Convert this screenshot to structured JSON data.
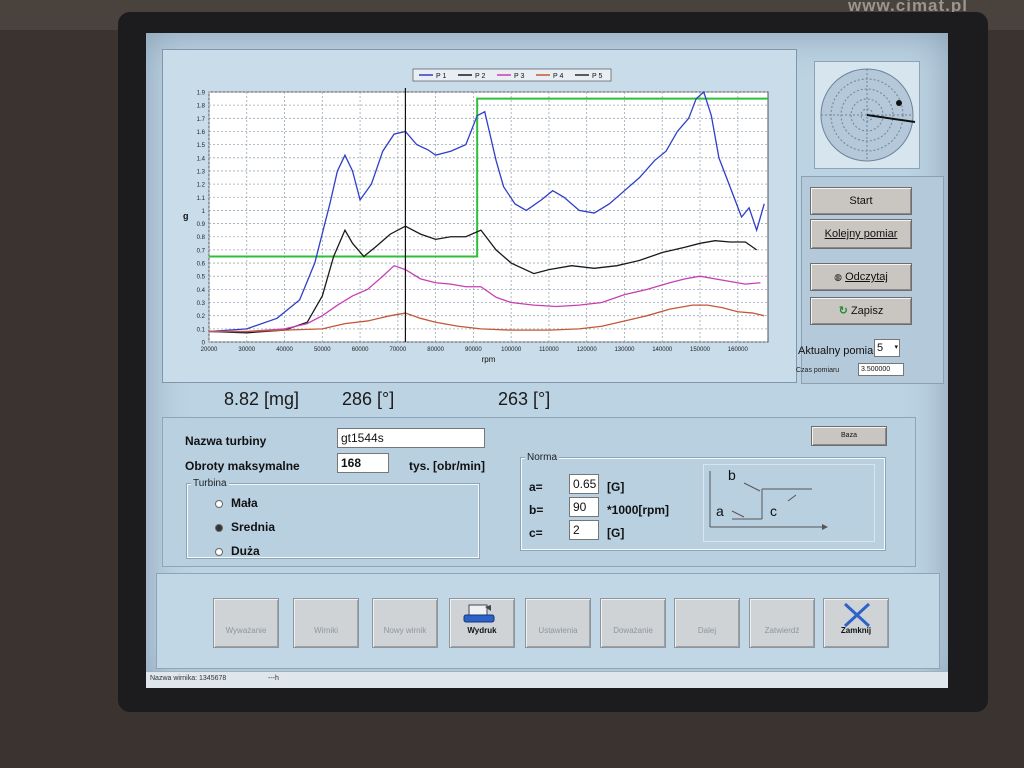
{
  "colors": {
    "p1": "#2f3fc8",
    "p2": "#1a1a1a",
    "p3": "#c83fb3",
    "p4": "#c2583a",
    "p5": "#2a2a2a",
    "threshold": "#2ec03a"
  },
  "chart_data": {
    "type": "line",
    "xlabel": "rpm",
    "ylabel": "g",
    "xlim": [
      20000,
      168000
    ],
    "ylim": [
      0,
      1.9
    ],
    "x_ticks": [
      20000,
      30000,
      40000,
      50000,
      60000,
      70000,
      80000,
      90000,
      100000,
      110000,
      120000,
      130000,
      140000,
      150000,
      160000
    ],
    "y_ticks": [
      0,
      0.1,
      0.2,
      0.3,
      0.4,
      0.5,
      0.6,
      0.7,
      0.8,
      0.9,
      1,
      1.1,
      1.2,
      1.3,
      1.4,
      1.5,
      1.6,
      1.7,
      1.8,
      1.9
    ],
    "legend_position": "top-center",
    "grid": true,
    "cursor_x": 72000,
    "series": [
      {
        "name": "P 1",
        "x": [
          20000,
          30000,
          38000,
          44000,
          48000,
          52000,
          54000,
          56000,
          58000,
          60000,
          63000,
          66000,
          69000,
          72000,
          75000,
          78000,
          80000,
          84000,
          88000,
          91000,
          93000,
          96000,
          98000,
          101000,
          104000,
          108000,
          111000,
          114000,
          118000,
          122000,
          126000,
          130000,
          134000,
          138000,
          141000,
          144000,
          147000,
          149000,
          151000,
          153000,
          155000,
          157000,
          159000,
          161000,
          163000,
          165000,
          167000
        ],
        "values": [
          0.08,
          0.1,
          0.18,
          0.32,
          0.6,
          1.05,
          1.3,
          1.42,
          1.3,
          1.08,
          1.2,
          1.45,
          1.58,
          1.6,
          1.5,
          1.46,
          1.42,
          1.45,
          1.5,
          1.72,
          1.75,
          1.38,
          1.18,
          1.05,
          1.0,
          1.08,
          1.15,
          1.1,
          1.0,
          0.98,
          1.05,
          1.15,
          1.25,
          1.38,
          1.45,
          1.6,
          1.7,
          1.85,
          1.9,
          1.72,
          1.4,
          1.25,
          1.1,
          0.95,
          1.02,
          0.85,
          1.05
        ]
      },
      {
        "name": "P 2",
        "x": [
          20000,
          30000,
          40000,
          46000,
          50000,
          53000,
          56000,
          58000,
          61000,
          64000,
          68000,
          72000,
          76000,
          80000,
          84000,
          88000,
          92000,
          96000,
          100000,
          106000,
          110000,
          116000,
          122000,
          128000,
          134000,
          140000,
          146000,
          150000,
          154000,
          158000,
          162000,
          165000
        ],
        "values": [
          0.08,
          0.07,
          0.09,
          0.15,
          0.35,
          0.65,
          0.85,
          0.75,
          0.65,
          0.72,
          0.82,
          0.88,
          0.82,
          0.78,
          0.8,
          0.8,
          0.85,
          0.7,
          0.6,
          0.52,
          0.55,
          0.58,
          0.56,
          0.58,
          0.62,
          0.68,
          0.72,
          0.75,
          0.77,
          0.76,
          0.76,
          0.7
        ]
      },
      {
        "name": "P 3",
        "x": [
          20000,
          30000,
          40000,
          46000,
          50000,
          54000,
          58000,
          62000,
          66000,
          69000,
          72000,
          76000,
          80000,
          84000,
          88000,
          92000,
          96000,
          100000,
          106000,
          112000,
          118000,
          124000,
          130000,
          136000,
          142000,
          146000,
          150000,
          154000,
          158000,
          162000,
          166000
        ],
        "values": [
          0.08,
          0.08,
          0.1,
          0.14,
          0.2,
          0.28,
          0.35,
          0.4,
          0.5,
          0.58,
          0.55,
          0.48,
          0.45,
          0.44,
          0.42,
          0.42,
          0.34,
          0.3,
          0.28,
          0.27,
          0.28,
          0.3,
          0.36,
          0.4,
          0.45,
          0.48,
          0.5,
          0.48,
          0.46,
          0.44,
          0.45
        ]
      },
      {
        "name": "P 4",
        "x": [
          20000,
          30000,
          40000,
          50000,
          56000,
          62000,
          68000,
          72000,
          76000,
          80000,
          86000,
          92000,
          100000,
          110000,
          118000,
          124000,
          130000,
          136000,
          142000,
          148000,
          152000,
          156000,
          160000,
          164000,
          167000
        ],
        "values": [
          0.08,
          0.08,
          0.09,
          0.1,
          0.14,
          0.16,
          0.2,
          0.22,
          0.18,
          0.15,
          0.12,
          0.1,
          0.09,
          0.09,
          0.1,
          0.12,
          0.16,
          0.2,
          0.25,
          0.28,
          0.28,
          0.26,
          0.23,
          0.22,
          0.2
        ]
      },
      {
        "name": "P 5",
        "x": [],
        "values": []
      }
    ],
    "threshold": {
      "x": [
        20000,
        91000,
        91000,
        168000
      ],
      "values": [
        0.65,
        0.65,
        1.85,
        1.85
      ]
    }
  },
  "readouts": {
    "mass": "8.82 [mg]",
    "angle1": "286 [°]",
    "angle2": "263 [°]"
  },
  "controls": {
    "start": "Start",
    "kolejny_pomiar": "Kolejny pomiar",
    "odczytaj": "Odczytaj",
    "zapisz": "Zapisz",
    "aktualny_pomiar_label": "Aktualny pomia",
    "aktualny_pomiar_value": "5",
    "czas_pomiaru_label": "Czas pomiaru",
    "czas_pomiaru_value": "3.500000"
  },
  "form": {
    "nazwa_turbiny_label": "Nazwa turbiny",
    "nazwa_turbiny_value": "gt1544s",
    "obroty_label": "Obroty maksymalne",
    "obroty_value": "168",
    "obroty_unit": "tys. [obr/min]",
    "baza_button": "Baza",
    "turbina_group": "Turbina",
    "turbina_options": [
      "Mała",
      "Srednia",
      "Duża"
    ],
    "turbina_selected": "Srednia",
    "norma_group": "Norma",
    "a_label": "a=",
    "a_value": "0.65",
    "a_unit": "[G]",
    "b_label": "b=",
    "b_value": "90",
    "b_unit": "*1000[rpm]",
    "c_label": "c=",
    "c_value": "2",
    "c_unit": "[G]",
    "schematic_a": "a",
    "schematic_b": "b",
    "schematic_c": "c"
  },
  "toolbar": {
    "wywazanie": "Wyważanie",
    "wirniki": "Wirniki",
    "nowy_wirnik": "Nowy wirnik",
    "wydruk": "Wydruk",
    "ustawienia": "Ustawienia",
    "dowazanie": "Doważanie",
    "dalej": "Dalej",
    "zatwierdz": "Zatwierdź",
    "zamknij": "Zamknij"
  },
  "status": {
    "nazwa_wirnika": "Nazwa wirnika: 1345678",
    "extra": "---h"
  },
  "url": "www.cimat.pl"
}
